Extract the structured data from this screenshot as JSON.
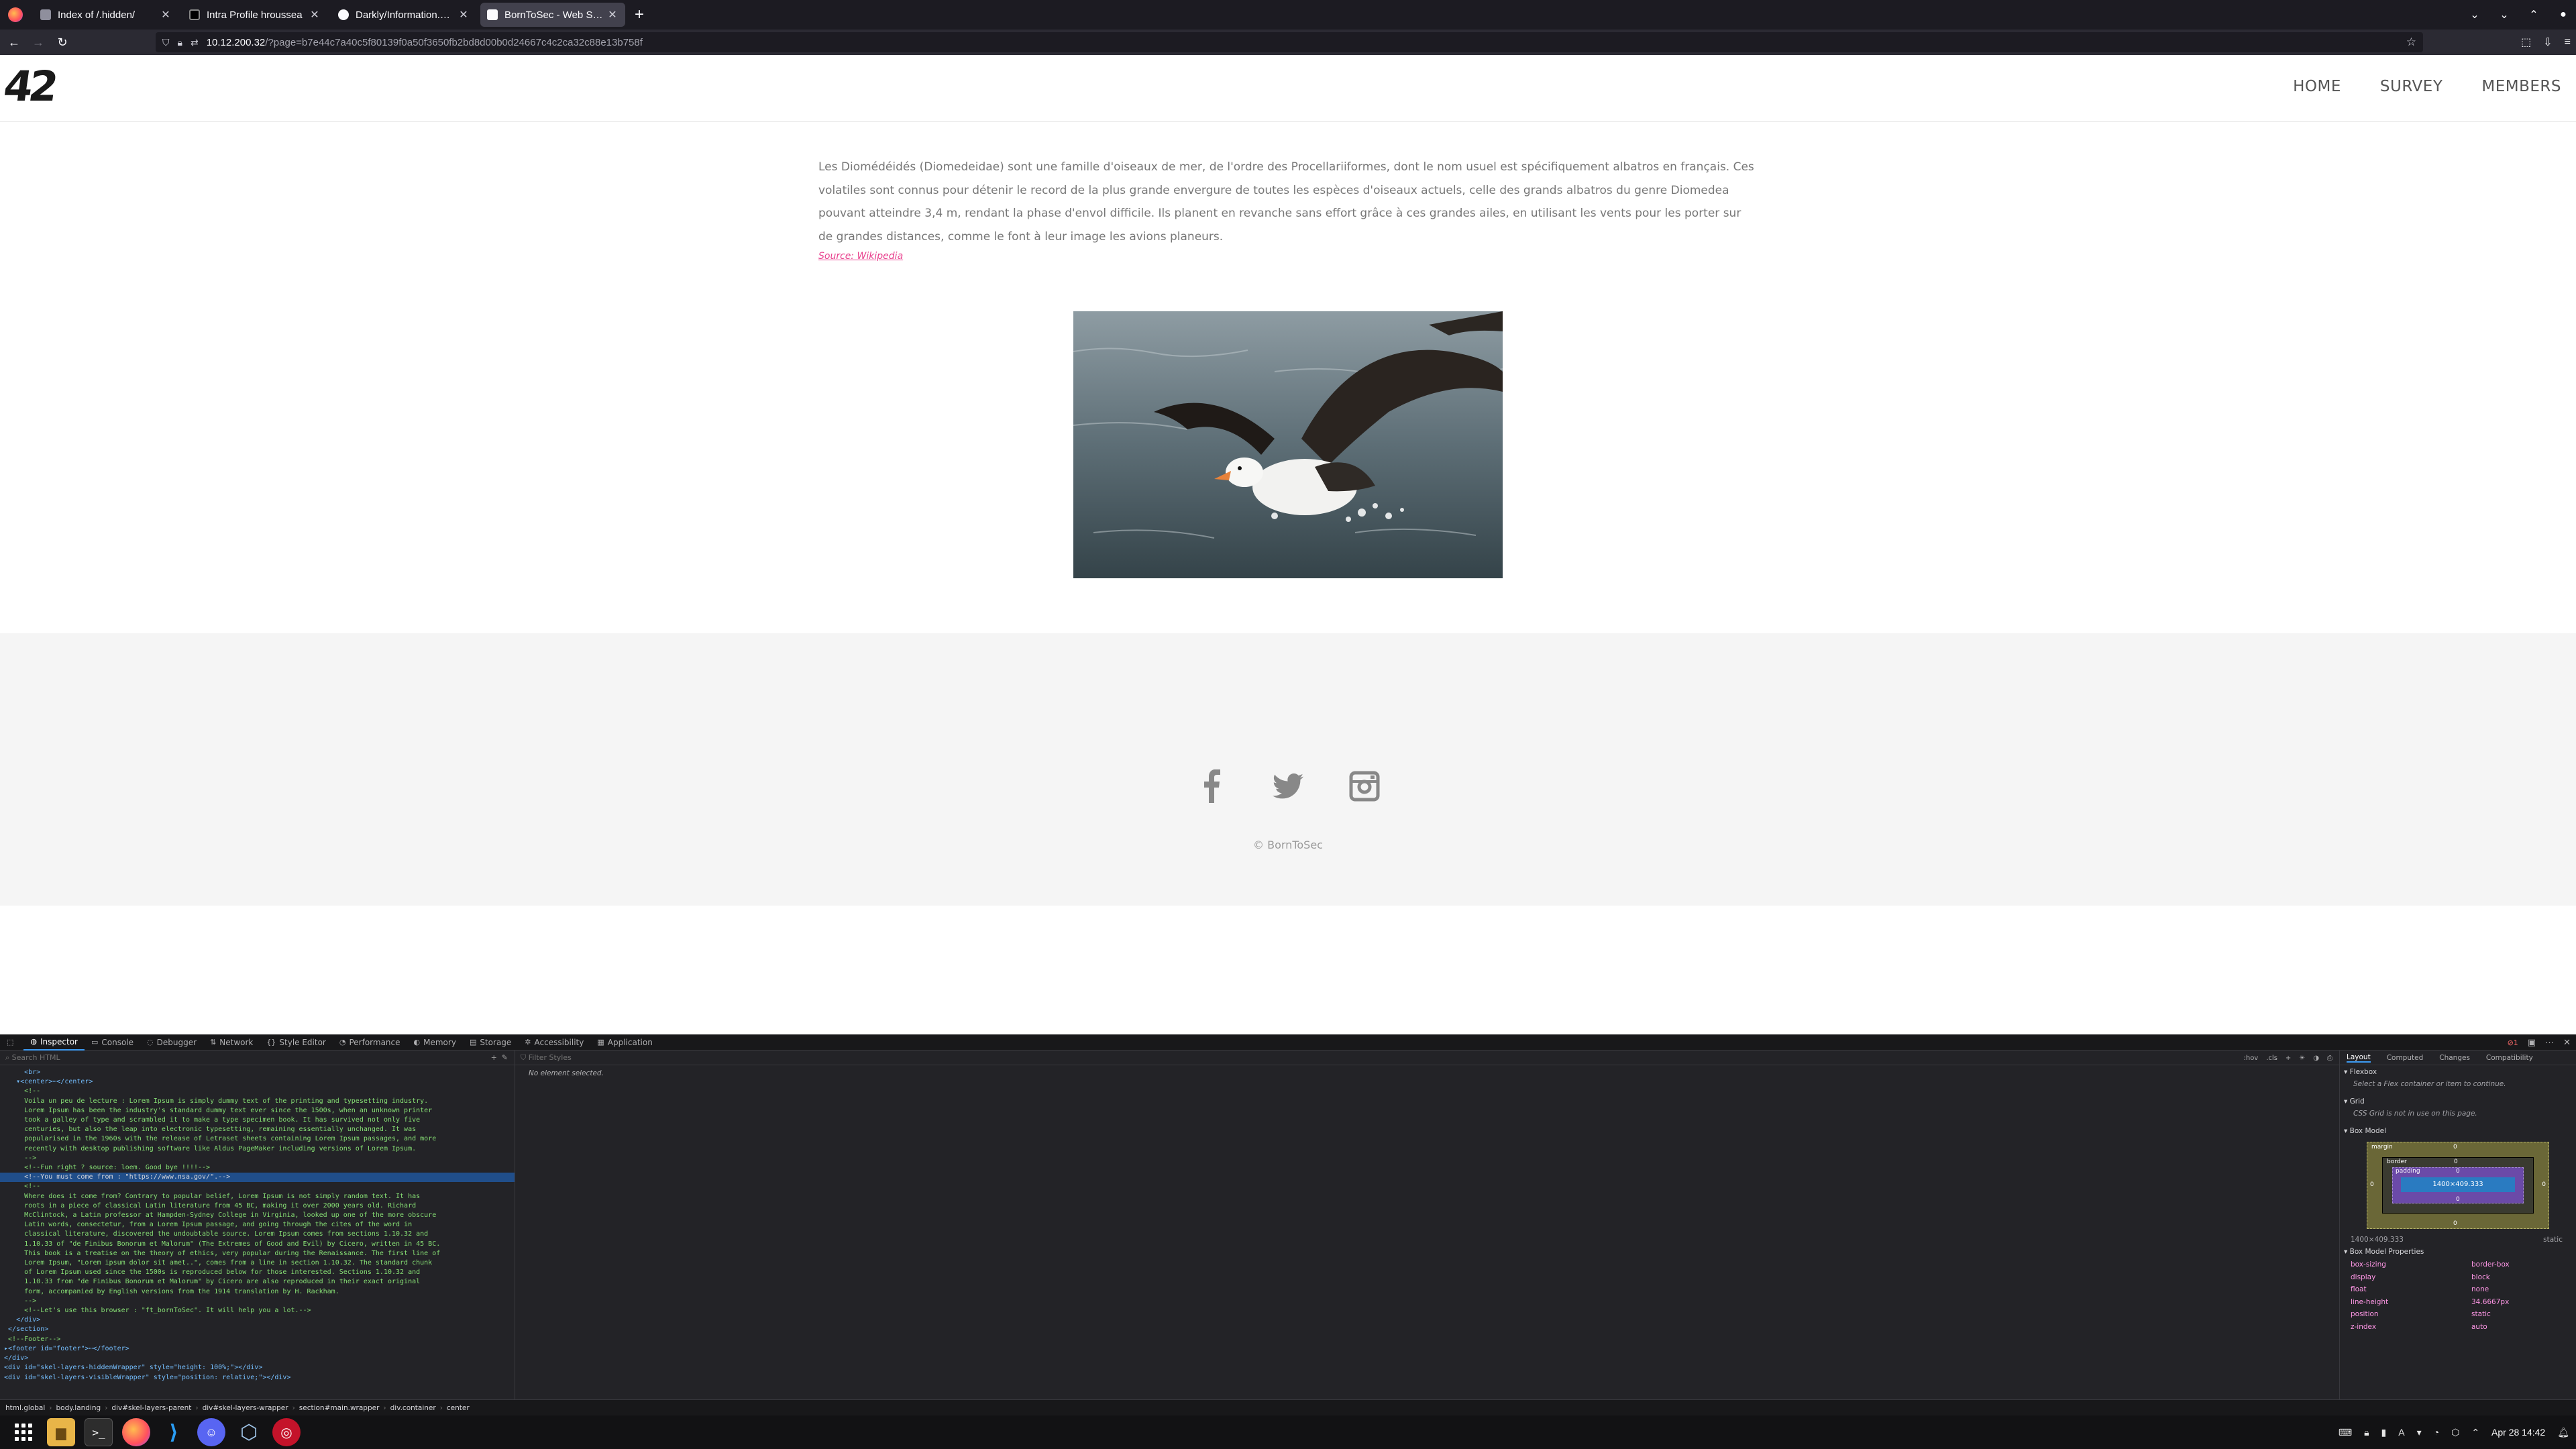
{
  "browser": {
    "tabs": [
      {
        "title": "Index of /.hidden/",
        "active": false
      },
      {
        "title": "Intra Profile hroussea",
        "active": false
      },
      {
        "title": "Darkly/Information.md at",
        "active": false
      },
      {
        "title": "BornToSec - Web Section",
        "active": true
      }
    ],
    "new_tab": "+",
    "url_host": "10.12.200.32",
    "url_rest": "/?page=b7e44c7a40c5f80139f0a50f3650fb2bd8d00b0d24667c4c2ca32c88e13b758f"
  },
  "site": {
    "logo": "42",
    "nav": [
      "HOME",
      "SURVEY",
      "MEMBERS"
    ],
    "article_text": "Les Diomédéidés (Diomedeidae) sont une famille d'oiseaux de mer, de l'ordre des Procellariiformes, dont le nom usuel est spécifiquement albatros en français. Ces volatiles sont connus pour détenir le record de la plus grande envergure de toutes les espèces d'oiseaux actuels, celle des grands albatros du genre Diomedea pouvant atteindre 3,4 m, rendant la phase d'envol difficile. Ils planent en revanche sans effort grâce à ces grandes ailes, en utilisant les vents pour les porter sur de grandes distances, comme le font à leur image les avions planeurs.",
    "source_link": "Source: Wikipedia",
    "copyright": "© BornToSec"
  },
  "devtools": {
    "tabs": [
      "Inspector",
      "Console",
      "Debugger",
      "Network",
      "Style Editor",
      "Performance",
      "Memory",
      "Storage",
      "Accessibility",
      "Application"
    ],
    "search_placeholder": "Search HTML",
    "filter_placeholder": "Filter Styles",
    "no_selection": "No element selected.",
    "markup_lines": [
      {
        "t": "      <br>",
        "k": "tag"
      },
      {
        "t": "    ▾<center>⋯</center>",
        "k": "tag"
      },
      {
        "t": "      <!--",
        "k": "comment"
      },
      {
        "t": "      Voila un peu de lecture : Lorem Ipsum is simply dummy text of the printing and typesetting industry.",
        "k": "comment"
      },
      {
        "t": "      Lorem Ipsum has been the industry's standard dummy text ever since the 1500s, when an unknown printer",
        "k": "comment"
      },
      {
        "t": "      took a galley of type and scrambled it to make a type specimen book. It has survived not only five",
        "k": "comment"
      },
      {
        "t": "      centuries, but also the leap into electronic typesetting, remaining essentially unchanged. It was",
        "k": "comment"
      },
      {
        "t": "      popularised in the 1960s with the release of Letraset sheets containing Lorem Ipsum passages, and more",
        "k": "comment"
      },
      {
        "t": "      recently with desktop publishing software like Aldus PageMaker including versions of Lorem Ipsum.",
        "k": "comment"
      },
      {
        "t": "      -->",
        "k": "comment"
      },
      {
        "t": "      <!--Fun right ? source: loem. Good bye !!!!-->",
        "k": "comment"
      },
      {
        "t": "      <!--You must come from : \"https://www.nsa.gov/\".-->",
        "k": "selected"
      },
      {
        "t": "      <!--",
        "k": "comment"
      },
      {
        "t": "      Where does it come from? Contrary to popular belief, Lorem Ipsum is not simply random text. It has",
        "k": "comment"
      },
      {
        "t": "      roots in a piece of classical Latin literature from 45 BC, making it over 2000 years old. Richard",
        "k": "comment"
      },
      {
        "t": "      McClintock, a Latin professor at Hampden-Sydney College in Virginia, looked up one of the more obscure",
        "k": "comment"
      },
      {
        "t": "      Latin words, consectetur, from a Lorem Ipsum passage, and going through the cites of the word in",
        "k": "comment"
      },
      {
        "t": "      classical literature, discovered the undoubtable source. Lorem Ipsum comes from sections 1.10.32 and",
        "k": "comment"
      },
      {
        "t": "      1.10.33 of \"de Finibus Bonorum et Malorum\" (The Extremes of Good and Evil) by Cicero, written in 45 BC.",
        "k": "comment"
      },
      {
        "t": "      This book is a treatise on the theory of ethics, very popular during the Renaissance. The first line of",
        "k": "comment"
      },
      {
        "t": "      Lorem Ipsum, \"Lorem ipsum dolor sit amet..\", comes from a line in section 1.10.32. The standard chunk",
        "k": "comment"
      },
      {
        "t": "      of Lorem Ipsum used since the 1500s is reproduced below for those interested. Sections 1.10.32 and",
        "k": "comment"
      },
      {
        "t": "      1.10.33 from \"de Finibus Bonorum et Malorum\" by Cicero are also reproduced in their exact original",
        "k": "comment"
      },
      {
        "t": "      form, accompanied by English versions from the 1914 translation by H. Rackham.",
        "k": "comment"
      },
      {
        "t": "      -->",
        "k": "comment"
      },
      {
        "t": "      <!--Let's use this browser : \"ft_bornToSec\". It will help you a lot.-->",
        "k": "comment"
      },
      {
        "t": "    </div>",
        "k": "tag"
      },
      {
        "t": "  </section>",
        "k": "tag"
      },
      {
        "t": "  <!--Footer-->",
        "k": "comment"
      },
      {
        "t": " ▸<footer id=\"footer\">⋯</footer>",
        "k": "tag"
      },
      {
        "t": " </div>",
        "k": "tag"
      },
      {
        "t": " <div id=\"skel-layers-hiddenWrapper\" style=\"height: 100%;\"></div>",
        "k": "tag"
      },
      {
        "t": " <div id=\"skel-layers-visibleWrapper\" style=\"position: relative;\"></div>",
        "k": "tag"
      }
    ],
    "breadcrumbs": [
      "html.global",
      "body.landing",
      "div#skel-layers-parent",
      "div#skel-layers-wrapper",
      "section#main.wrapper",
      "div.container",
      "center"
    ],
    "layout": {
      "tabs": [
        "Layout",
        "Computed",
        "Changes",
        "Compatibility"
      ],
      "flexbox_title": "Flexbox",
      "flexbox_msg": "Select a Flex container or item to continue.",
      "grid_title": "Grid",
      "grid_msg": "CSS Grid is not in use on this page.",
      "boxmodel_title": "Box Model",
      "bm_margin": "margin",
      "bm_border": "border",
      "bm_padding": "padding",
      "bm_content": "1400×409.333",
      "bm_dims": "1400×409.333",
      "bm_position": "static",
      "props_title": "Box Model Properties",
      "props": [
        {
          "k": "box-sizing",
          "v": "border-box"
        },
        {
          "k": "display",
          "v": "block"
        },
        {
          "k": "float",
          "v": "none"
        },
        {
          "k": "line-height",
          "v": "34.6667px"
        },
        {
          "k": "position",
          "v": "static"
        },
        {
          "k": "z-index",
          "v": "auto"
        }
      ]
    }
  },
  "taskbar": {
    "clock": "Apr 28  14:42",
    "keyboard": "A"
  }
}
